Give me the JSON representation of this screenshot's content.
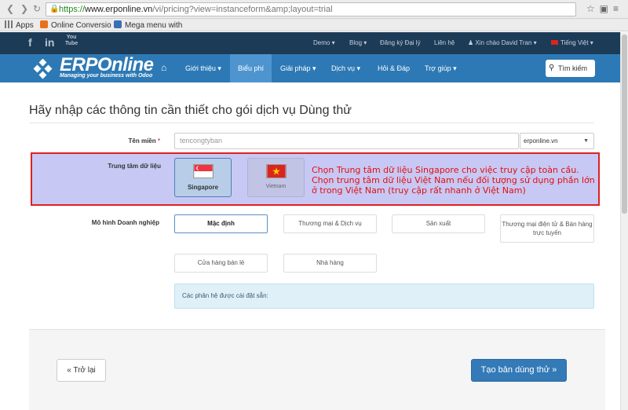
{
  "browser": {
    "url_scheme": "https://",
    "url_host": "www.erponline.vn",
    "url_path": "/vi/pricing?view=instanceform&amp;layout=trial",
    "bookmarks": [
      "Apps",
      "Online Conversio",
      "Mega menu with"
    ]
  },
  "topbar": {
    "social": [
      "f",
      "in",
      "You\nTube"
    ],
    "items": [
      "Demo ▾",
      "Blog ▾",
      "Đăng ký Đại lý",
      "Liên hệ",
      "Xin chào David Tran ▾",
      "Tiếng Việt ▾"
    ]
  },
  "mainnav": {
    "logo_text": "ERPOnline",
    "logo_tagline": "Managing your business with Odoo",
    "items": [
      {
        "label": "Giới thiệu ▾",
        "active": false
      },
      {
        "label": "Biểu phí",
        "active": true
      },
      {
        "label": "Giải pháp ▾",
        "active": false
      },
      {
        "label": "Dịch vụ ▾",
        "active": false
      },
      {
        "label": "Hỏi & Đáp",
        "active": false
      },
      {
        "label": "Trợ giúp ▾",
        "active": false
      }
    ],
    "search_label": "Tìm kiếm"
  },
  "form": {
    "title": "Hãy nhập các thông tin cần thiết cho gói dịch vụ Dùng thử",
    "domain_label": "Tên miền",
    "required_mark": "*",
    "domain_value": "tencongtyban",
    "domain_suffix": "erponline.vn",
    "datacenter_label": "Trung tâm dữ liệu",
    "datacenters": [
      {
        "name": "Singapore",
        "selected": true
      },
      {
        "name": "Vietnam",
        "selected": false
      }
    ],
    "datacenter_note": "Chọn Trung tâm dữ liệu Singapore cho việc truy cập toàn cầu. Chọn trung tâm dữ liệu Việt Nam nếu đối tượng sử dụng phần lớn ở trong Việt Nam (truy cập rất nhanh ở Việt Nam)",
    "business_model_label": "Mô hình Doanh nghiệp",
    "business_models": [
      "Mặc định",
      "Thương mại & Dịch vụ",
      "Sản xuất",
      "Thương mại điện tử & Bán hàng trực tuyến",
      "Cửa hàng bán lẻ",
      "Nhà hàng"
    ],
    "installed_modules_text": "Các phân hệ được cài đặt sẵn:",
    "back_label": "« Trở lại",
    "submit_label": "Tạo bản dùng thử »"
  },
  "colors": {
    "topnav_bg": "#1c3b57",
    "mainnav_bg": "#2d79b5",
    "primary_button": "#337ab7",
    "note_text": "#e01010",
    "note_border": "#e02020"
  }
}
